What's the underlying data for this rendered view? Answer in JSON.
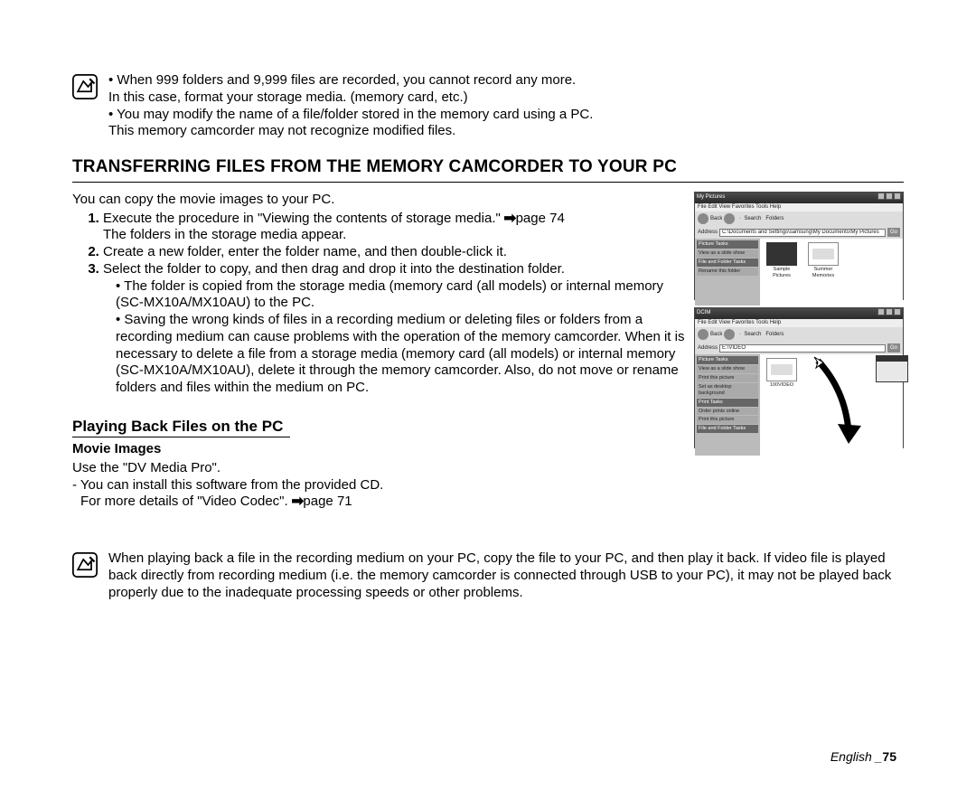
{
  "note1": {
    "items": [
      "When 999 folders and 9,999 files are recorded, you cannot record any more.\nIn this case, format your storage media. (memory card, etc.)",
      "You may modify the name of a file/folder stored in the memory card using a PC.\nThis memory camcorder may not recognize modified files."
    ]
  },
  "heading1": "TRANSFERRING FILES FROM THE MEMORY CAMCORDER TO YOUR PC",
  "intro": "You can copy the movie images to your PC.",
  "steps": {
    "s1_a": "Execute the procedure in \"Viewing the contents of storage media.\" ",
    "s1_b": "page 74",
    "s1_c": "The folders in the storage media appear.",
    "s2": "Create a new folder, enter the folder name, and then double-click it.",
    "s3": "Select the folder to copy, and then drag and drop it into the destination folder.",
    "s3_sub": [
      "The folder is copied from the storage media (memory card (all models) or internal memory (SC-MX10A/MX10AU) to the PC.",
      "Saving the wrong kinds of files in a recording medium or deleting files or folders from a recording medium can cause problems with the operation of the memory camcorder. When it is necessary to delete a file from a storage media (memory card (all models) or internal memory (SC-MX10A/MX10AU), delete it through the memory camcorder. Also, do not move or rename folders and files within the medium on PC."
    ]
  },
  "heading2": "Playing Back Files on the PC",
  "heading3": "Movie  Images",
  "movie_lines": {
    "l1": "Use the \"DV Media Pro\".",
    "l2": "- You can install this software from the provided CD.",
    "l3_a": "For more details of \"Video Codec\". ",
    "l3_b": "page 71"
  },
  "note2": "When playing back a file in the recording medium on your PC, copy the file to your PC, and then play it back. If video file is played back directly from recording medium (i.e. the memory camcorder is connected through USB to your PC), it may not be played back properly due to the inadequate processing speeds or other problems.",
  "footer": {
    "lang": "English _",
    "page": "75"
  },
  "win1": {
    "title": "My Pictures",
    "menu": "File   Edit   View   Favorites   Tools   Help",
    "toolbar": {
      "back": "Back",
      "search": "Search",
      "folders": "Folders"
    },
    "address": "C:\\Documents and Settings\\samsung\\My Documents\\My Pictures",
    "go": "Go",
    "side_tasks_head": "Picture Tasks",
    "side_tasks_item": "View as a slide show",
    "side_ff_head": "File and Folder Tasks",
    "side_ff_item": "Rename this folder",
    "thumb1": "Sample Pictures",
    "thumb2": "Summer Memories"
  },
  "win2": {
    "title": "DCIM",
    "menu": "File   Edit   View   Favorites   Tools   Help",
    "toolbar": {
      "back": "Back",
      "search": "Search",
      "folders": "Folders"
    },
    "address": "E:\\VIDEO",
    "go": "Go",
    "side_tasks_head": "Picture Tasks",
    "side_items": [
      "View as a slide show",
      "Print this picture",
      "Set as desktop background"
    ],
    "side_print_head": "Print Tasks",
    "side_print_items": [
      "Order prints online",
      "Print this picture"
    ],
    "side_ff_head": "File and Folder Tasks",
    "folder": "100VIDEO"
  }
}
